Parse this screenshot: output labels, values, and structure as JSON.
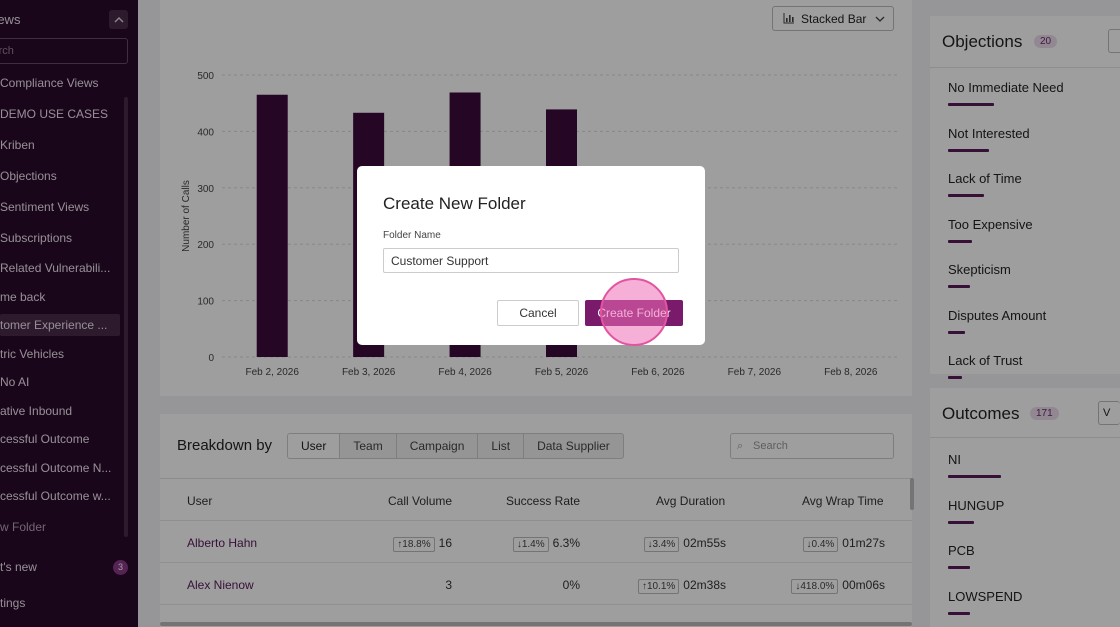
{
  "sidebar": {
    "views_title": "Views",
    "search_placeholder": "Search",
    "items": [
      "Compliance Views",
      "DEMO USE CASES",
      "Kriben",
      "Objections",
      "Sentiment Views",
      "Subscriptions",
      "Related Vulnerabili...",
      "me back",
      "tomer Experience ...",
      "tric Vehicles",
      "No AI",
      "ative Inbound",
      "cessful Outcome",
      "cessful Outcome N...",
      "cessful Outcome w..."
    ],
    "new_folder": "w Folder",
    "whats_new": "t's new",
    "whats_new_count": "3",
    "settings": "tings"
  },
  "chart_toolbar": {
    "chart_type": "Stacked Bar"
  },
  "chart_data": {
    "type": "bar",
    "categories": [
      "Feb 2, 2026",
      "Feb 3, 2026",
      "Feb 4, 2026",
      "Feb 5, 2026",
      "Feb 6, 2026",
      "Feb 7, 2026",
      "Feb 8, 2026"
    ],
    "values": [
      465,
      433,
      469,
      439,
      null,
      null,
      null
    ],
    "ylabel": "Number of Calls",
    "ylim": [
      0,
      500
    ],
    "yticks": [
      "0",
      "100",
      "200",
      "300",
      "400",
      "500"
    ],
    "bar_color": "#3d0a3d"
  },
  "breakdown": {
    "title": "Breakdown by",
    "tabs": [
      "User",
      "Team",
      "Campaign",
      "List",
      "Data Supplier"
    ],
    "active_tab": "User",
    "search_placeholder": "Search",
    "columns": [
      "User",
      "Call Volume",
      "Success Rate",
      "Avg Duration",
      "Avg Wrap Time"
    ],
    "rows": [
      {
        "user": "Alberto Hahn",
        "vol_delta": "18.8%",
        "vol_dir": "up",
        "volume": "16",
        "sr_delta": "1.4%",
        "sr_dir": "down",
        "success": "6.3%",
        "dur_delta": "3.4%",
        "dur_dir": "down",
        "duration": "02m55s",
        "wrap_delta": "0.4%",
        "wrap_dir": "down",
        "wrap": "01m27s"
      },
      {
        "user": "Alex Nienow",
        "vol_delta": "",
        "vol_dir": "",
        "volume": "3",
        "sr_delta": "",
        "sr_dir": "",
        "success": "0%",
        "dur_delta": "10.1%",
        "dur_dir": "up",
        "duration": "02m38s",
        "wrap_delta": "418.0%",
        "wrap_dir": "down",
        "wrap": "00m06s"
      }
    ]
  },
  "objections": {
    "title": "Objections",
    "count": "20",
    "items": [
      {
        "label": "No Immediate Need",
        "level": 0.27
      },
      {
        "label": "Not Interested",
        "level": 0.24
      },
      {
        "label": "Lack of Time",
        "level": 0.21
      },
      {
        "label": "Too Expensive",
        "level": 0.14
      },
      {
        "label": "Skepticism",
        "level": 0.13
      },
      {
        "label": "Disputes Amount",
        "level": 0.1
      },
      {
        "label": "Lack of Trust",
        "level": 0.08
      }
    ]
  },
  "outcomes": {
    "title": "Outcomes",
    "count": "171",
    "button": "V",
    "items": [
      {
        "label": "NI",
        "level": 0.31
      },
      {
        "label": "HUNGUP",
        "level": 0.15
      },
      {
        "label": "PCB",
        "level": 0.13
      },
      {
        "label": "LOWSPEND",
        "level": 0.13
      }
    ]
  },
  "modal": {
    "title": "Create New Folder",
    "field_label": "Folder Name",
    "field_value": "Customer Support",
    "cancel": "Cancel",
    "create": "Create Folder"
  }
}
